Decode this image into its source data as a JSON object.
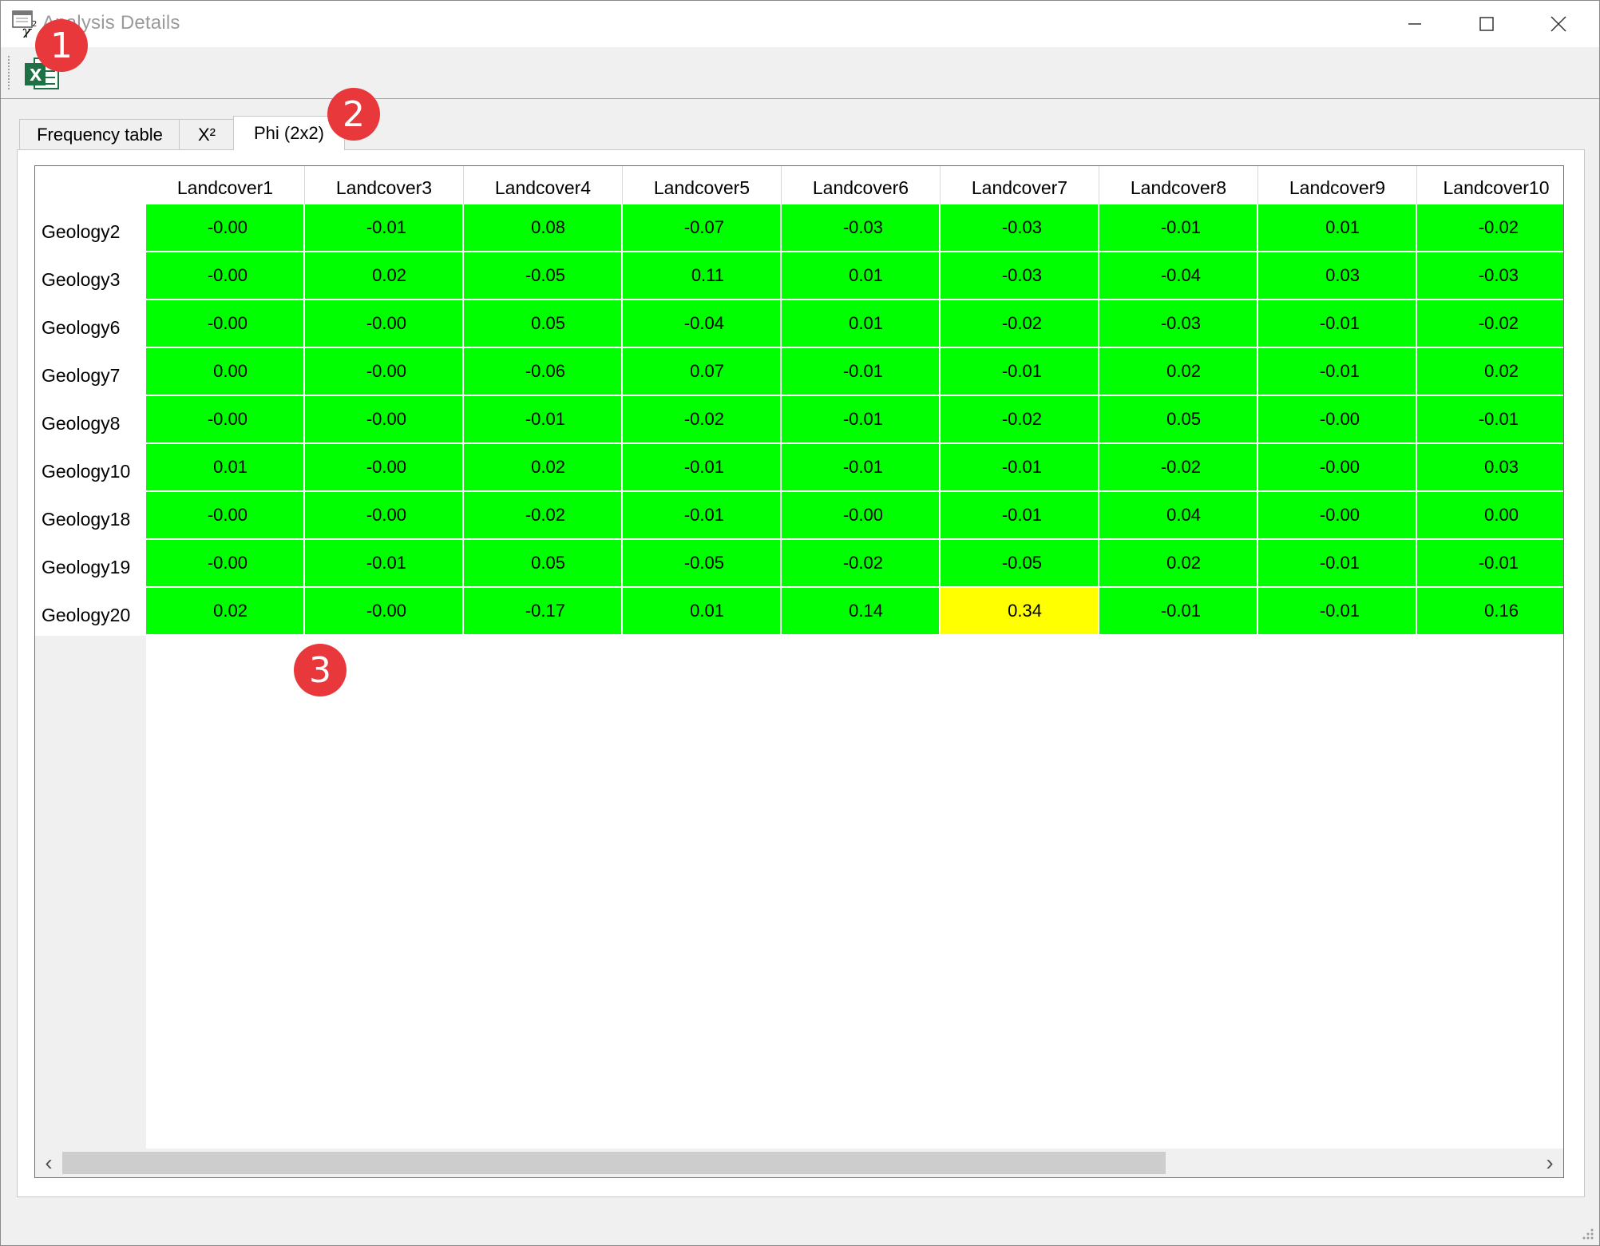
{
  "window": {
    "title": "Analysis Details",
    "icon": "chi-square-app-icon",
    "controls": [
      "minimize",
      "maximize",
      "close"
    ]
  },
  "toolbar": {
    "export_icon": "excel-icon",
    "export_label": "X"
  },
  "tabs": [
    {
      "label": "Frequency table",
      "active": false
    },
    {
      "label": "X²",
      "active": false
    },
    {
      "label": "Phi (2x2)",
      "active": true
    }
  ],
  "table": {
    "columns": [
      "Landcover1",
      "Landcover3",
      "Landcover4",
      "Landcover5",
      "Landcover6",
      "Landcover7",
      "Landcover8",
      "Landcover9",
      "Landcover10"
    ],
    "rows": [
      {
        "label": "Geology2",
        "values": [
          "-0.00",
          "-0.01",
          "0.08",
          "-0.07",
          "-0.03",
          "-0.03",
          "-0.01",
          "0.01",
          "-0.02"
        ]
      },
      {
        "label": "Geology3",
        "values": [
          "-0.00",
          "0.02",
          "-0.05",
          "0.11",
          "0.01",
          "-0.03",
          "-0.04",
          "0.03",
          "-0.03"
        ]
      },
      {
        "label": "Geology6",
        "values": [
          "-0.00",
          "-0.00",
          "0.05",
          "-0.04",
          "0.01",
          "-0.02",
          "-0.03",
          "-0.01",
          "-0.02"
        ]
      },
      {
        "label": "Geology7",
        "values": [
          "0.00",
          "-0.00",
          "-0.06",
          "0.07",
          "-0.01",
          "-0.01",
          "0.02",
          "-0.01",
          "0.02"
        ]
      },
      {
        "label": "Geology8",
        "values": [
          "-0.00",
          "-0.00",
          "-0.01",
          "-0.02",
          "-0.01",
          "-0.02",
          "0.05",
          "-0.00",
          "-0.01"
        ]
      },
      {
        "label": "Geology10",
        "values": [
          "0.01",
          "-0.00",
          "0.02",
          "-0.01",
          "-0.01",
          "-0.01",
          "-0.02",
          "-0.00",
          "0.03"
        ]
      },
      {
        "label": "Geology18",
        "values": [
          "-0.00",
          "-0.00",
          "-0.02",
          "-0.01",
          "-0.00",
          "-0.01",
          "0.04",
          "-0.00",
          "0.00"
        ]
      },
      {
        "label": "Geology19",
        "values": [
          "-0.00",
          "-0.01",
          "0.05",
          "-0.05",
          "-0.02",
          "-0.05",
          "0.02",
          "-0.01",
          "-0.01"
        ]
      },
      {
        "label": "Geology20",
        "values": [
          "0.02",
          "-0.00",
          "-0.17",
          "0.01",
          "0.14",
          "0.34",
          "-0.01",
          "-0.01",
          "0.16"
        ]
      }
    ],
    "highlight": {
      "row": 8,
      "col": 5
    },
    "colors": {
      "normal": "#00ff00",
      "highlight": "#ffff00"
    }
  },
  "scrollbar": {
    "left_glyph": "‹",
    "right_glyph": "›"
  },
  "markers": [
    "1",
    "2",
    "3"
  ],
  "colors": {
    "marker": "#e8383b"
  }
}
